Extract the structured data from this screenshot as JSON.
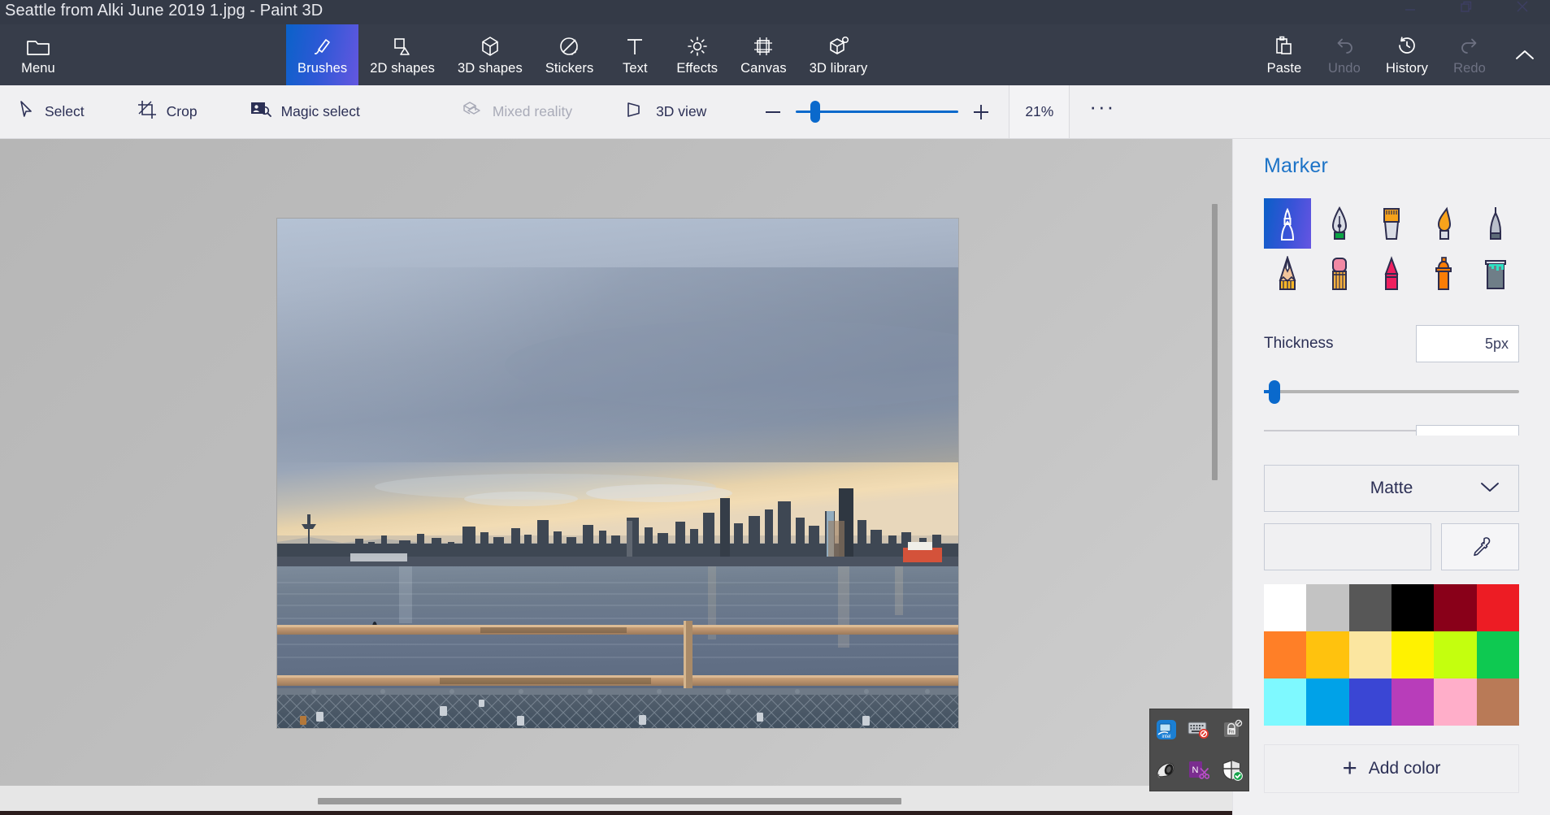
{
  "window": {
    "title": "Seattle from Alki June 2019 1.jpg - Paint 3D",
    "controls": {
      "minimize": "minimize-icon",
      "restore": "restore-icon",
      "close": "close-icon"
    }
  },
  "ribbon": {
    "menu": {
      "label": "Menu",
      "icon": "folder-icon"
    },
    "tools": [
      {
        "label": "Brushes",
        "icon": "brush-icon",
        "active": true,
        "disabled": false
      },
      {
        "label": "2D shapes",
        "icon": "2d-shapes-icon",
        "active": false,
        "disabled": false
      },
      {
        "label": "3D shapes",
        "icon": "3d-shapes-icon",
        "active": false,
        "disabled": false
      },
      {
        "label": "Stickers",
        "icon": "stickers-icon",
        "active": false,
        "disabled": false
      },
      {
        "label": "Text",
        "icon": "text-icon",
        "active": false,
        "disabled": false
      },
      {
        "label": "Effects",
        "icon": "effects-icon",
        "active": false,
        "disabled": false
      },
      {
        "label": "Canvas",
        "icon": "canvas-icon",
        "active": false,
        "disabled": false
      },
      {
        "label": "3D library",
        "icon": "3d-library-icon",
        "active": false,
        "disabled": false
      }
    ],
    "right": [
      {
        "label": "Paste",
        "icon": "clipboard-icon",
        "disabled": false
      },
      {
        "label": "Undo",
        "icon": "undo-icon",
        "disabled": true
      },
      {
        "label": "History",
        "icon": "history-icon",
        "disabled": false
      },
      {
        "label": "Redo",
        "icon": "redo-icon",
        "disabled": true
      }
    ],
    "collapse": "chevron-up-icon"
  },
  "subtoolbar": {
    "items": [
      {
        "label": "Select",
        "icon": "cursor-icon",
        "disabled": false
      },
      {
        "label": "Crop",
        "icon": "crop-icon",
        "disabled": false
      },
      {
        "label": "Magic select",
        "icon": "magic-select-icon",
        "disabled": false
      },
      {
        "label": "Mixed reality",
        "icon": "mixed-reality-icon",
        "disabled": true
      },
      {
        "label": "3D view",
        "icon": "3d-view-icon",
        "disabled": false
      }
    ],
    "zoom_out": "minus-icon",
    "zoom_in": "plus-icon",
    "zoom_value": "21%",
    "more": "ellipsis-icon",
    "slider_percent": 12
  },
  "panel": {
    "title": "Marker",
    "brushes": [
      {
        "name": "marker",
        "selected": true
      },
      {
        "name": "calligraphy-pen",
        "selected": false
      },
      {
        "name": "oil-brush",
        "selected": false
      },
      {
        "name": "watercolor",
        "selected": false
      },
      {
        "name": "pixel-pen",
        "selected": false
      },
      {
        "name": "pencil",
        "selected": false
      },
      {
        "name": "eraser",
        "selected": false
      },
      {
        "name": "crayon",
        "selected": false
      },
      {
        "name": "spray-can",
        "selected": false
      },
      {
        "name": "fill-bucket",
        "selected": false
      }
    ],
    "thickness": {
      "label": "Thickness",
      "value": "5px",
      "slider_percent": 4
    },
    "material": {
      "value": "Matte",
      "chevron": "chevron-down-icon"
    },
    "eyedropper": "eyedropper-icon",
    "palette": [
      "#ffffff",
      "#c3c3c3",
      "#575757",
      "#000000",
      "#890019",
      "#ed1c24",
      "#ff7f27",
      "#ffc20e",
      "#fbe6a0",
      "#fff200",
      "#c4ff0e",
      "#0ec951",
      "#7ef9ff",
      "#00a2e8",
      "#3a46d4",
      "#b83dba",
      "#ffaec9",
      "#b97a57"
    ],
    "add_color": {
      "label": "Add color",
      "icon": "plus-icon"
    }
  },
  "tray": {
    "icons": [
      "intel-graphics-icon",
      "keyboard-disabled-icon",
      "fn-lock-icon",
      "speaker-icon",
      "onenote-clipper-icon",
      "windows-defender-shield-icon"
    ]
  },
  "canvas": {
    "image_alt": "Seattle skyline from Alki Beach at sunset with pier railing",
    "scrollbars": {
      "vertical": "vertical-scrollbar",
      "horizontal": "horizontal-scrollbar"
    }
  }
}
